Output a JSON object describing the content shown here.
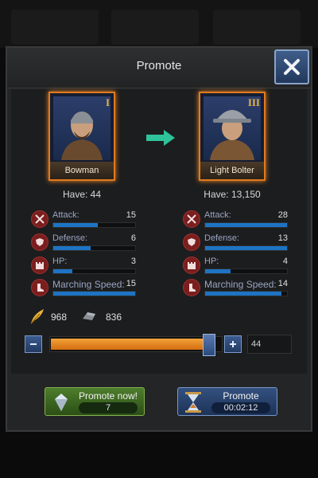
{
  "dialog": {
    "title": "Promote"
  },
  "from_unit": {
    "tier": "I",
    "name": "Bowman",
    "have": "Have: 44"
  },
  "to_unit": {
    "tier": "III",
    "name": "Light Bolter",
    "have": "Have: 13,150"
  },
  "from_stats": [
    {
      "label": "Attack:",
      "value": "15",
      "level": 0.54
    },
    {
      "label": "Defense:",
      "value": "6",
      "level": 0.46
    },
    {
      "label": "HP:",
      "value": "3",
      "level": 0.23
    },
    {
      "label": "Marching Speed:",
      "value": "15",
      "level": 1.0
    }
  ],
  "to_stats": [
    {
      "label": "Attack:",
      "value": "28",
      "level": 1.0
    },
    {
      "label": "Defense:",
      "value": "13",
      "level": 1.0
    },
    {
      "label": "HP:",
      "value": "4",
      "level": 0.31
    },
    {
      "label": "Marching Speed:",
      "value": "14",
      "level": 0.93
    }
  ],
  "resources": {
    "feather": "968",
    "iron": "836"
  },
  "slider": {
    "quantity": "44",
    "level": 0.97
  },
  "buttons": {
    "promote_now_label": "Promote now!",
    "promote_now_cost": "7",
    "promote_label": "Promote",
    "promote_time": "00:02:12"
  },
  "colors": {
    "accent": "#e07a1f",
    "bar": "#1e74c4",
    "stat_icon": "#7a1e1e"
  }
}
